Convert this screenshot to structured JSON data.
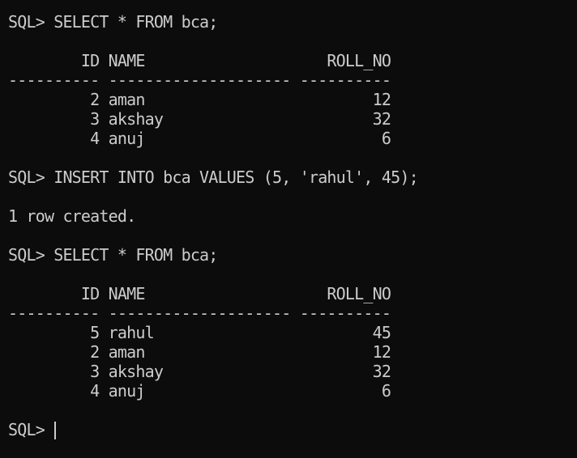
{
  "terminal": {
    "lines": [
      "SQL> SELECT * FROM bca;",
      "",
      "        ID NAME                    ROLL_NO",
      "---------- -------------------- ----------",
      "         2 aman                         12",
      "         3 akshay                       32",
      "         4 anuj                          6",
      "",
      "SQL> INSERT INTO bca VALUES (5, 'rahul', 45);",
      "",
      "1 row created.",
      "",
      "SQL> SELECT * FROM bca;",
      "",
      "        ID NAME                    ROLL_NO",
      "---------- -------------------- ----------",
      "         5 rahul                        45",
      "         2 aman                         12",
      "         3 akshay                       32",
      "         4 anuj                          6",
      ""
    ],
    "prompt": "SQL> "
  }
}
